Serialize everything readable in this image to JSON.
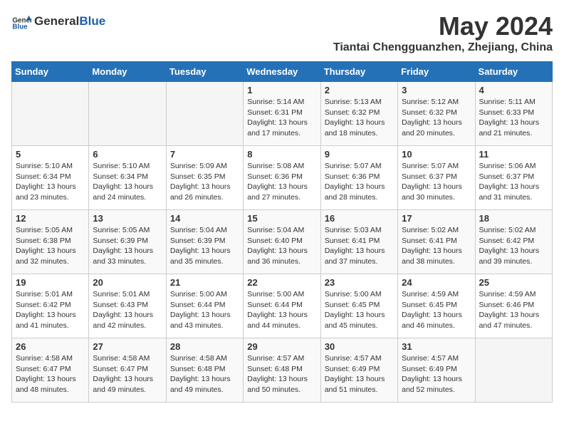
{
  "header": {
    "logo_general": "General",
    "logo_blue": "Blue",
    "month_title": "May 2024",
    "location": "Tiantai Chengguanzhen, Zhejiang, China"
  },
  "weekdays": [
    "Sunday",
    "Monday",
    "Tuesday",
    "Wednesday",
    "Thursday",
    "Friday",
    "Saturday"
  ],
  "weeks": [
    [
      {
        "day": "",
        "sunrise": "",
        "sunset": "",
        "daylight": ""
      },
      {
        "day": "",
        "sunrise": "",
        "sunset": "",
        "daylight": ""
      },
      {
        "day": "",
        "sunrise": "",
        "sunset": "",
        "daylight": ""
      },
      {
        "day": "1",
        "sunrise": "5:14 AM",
        "sunset": "6:31 PM",
        "daylight": "13 hours and 17 minutes."
      },
      {
        "day": "2",
        "sunrise": "5:13 AM",
        "sunset": "6:32 PM",
        "daylight": "13 hours and 18 minutes."
      },
      {
        "day": "3",
        "sunrise": "5:12 AM",
        "sunset": "6:32 PM",
        "daylight": "13 hours and 20 minutes."
      },
      {
        "day": "4",
        "sunrise": "5:11 AM",
        "sunset": "6:33 PM",
        "daylight": "13 hours and 21 minutes."
      }
    ],
    [
      {
        "day": "5",
        "sunrise": "5:10 AM",
        "sunset": "6:34 PM",
        "daylight": "13 hours and 23 minutes."
      },
      {
        "day": "6",
        "sunrise": "5:10 AM",
        "sunset": "6:34 PM",
        "daylight": "13 hours and 24 minutes."
      },
      {
        "day": "7",
        "sunrise": "5:09 AM",
        "sunset": "6:35 PM",
        "daylight": "13 hours and 26 minutes."
      },
      {
        "day": "8",
        "sunrise": "5:08 AM",
        "sunset": "6:36 PM",
        "daylight": "13 hours and 27 minutes."
      },
      {
        "day": "9",
        "sunrise": "5:07 AM",
        "sunset": "6:36 PM",
        "daylight": "13 hours and 28 minutes."
      },
      {
        "day": "10",
        "sunrise": "5:07 AM",
        "sunset": "6:37 PM",
        "daylight": "13 hours and 30 minutes."
      },
      {
        "day": "11",
        "sunrise": "5:06 AM",
        "sunset": "6:37 PM",
        "daylight": "13 hours and 31 minutes."
      }
    ],
    [
      {
        "day": "12",
        "sunrise": "5:05 AM",
        "sunset": "6:38 PM",
        "daylight": "13 hours and 32 minutes."
      },
      {
        "day": "13",
        "sunrise": "5:05 AM",
        "sunset": "6:39 PM",
        "daylight": "13 hours and 33 minutes."
      },
      {
        "day": "14",
        "sunrise": "5:04 AM",
        "sunset": "6:39 PM",
        "daylight": "13 hours and 35 minutes."
      },
      {
        "day": "15",
        "sunrise": "5:04 AM",
        "sunset": "6:40 PM",
        "daylight": "13 hours and 36 minutes."
      },
      {
        "day": "16",
        "sunrise": "5:03 AM",
        "sunset": "6:41 PM",
        "daylight": "13 hours and 37 minutes."
      },
      {
        "day": "17",
        "sunrise": "5:02 AM",
        "sunset": "6:41 PM",
        "daylight": "13 hours and 38 minutes."
      },
      {
        "day": "18",
        "sunrise": "5:02 AM",
        "sunset": "6:42 PM",
        "daylight": "13 hours and 39 minutes."
      }
    ],
    [
      {
        "day": "19",
        "sunrise": "5:01 AM",
        "sunset": "6:42 PM",
        "daylight": "13 hours and 41 minutes."
      },
      {
        "day": "20",
        "sunrise": "5:01 AM",
        "sunset": "6:43 PM",
        "daylight": "13 hours and 42 minutes."
      },
      {
        "day": "21",
        "sunrise": "5:00 AM",
        "sunset": "6:44 PM",
        "daylight": "13 hours and 43 minutes."
      },
      {
        "day": "22",
        "sunrise": "5:00 AM",
        "sunset": "6:44 PM",
        "daylight": "13 hours and 44 minutes."
      },
      {
        "day": "23",
        "sunrise": "5:00 AM",
        "sunset": "6:45 PM",
        "daylight": "13 hours and 45 minutes."
      },
      {
        "day": "24",
        "sunrise": "4:59 AM",
        "sunset": "6:45 PM",
        "daylight": "13 hours and 46 minutes."
      },
      {
        "day": "25",
        "sunrise": "4:59 AM",
        "sunset": "6:46 PM",
        "daylight": "13 hours and 47 minutes."
      }
    ],
    [
      {
        "day": "26",
        "sunrise": "4:58 AM",
        "sunset": "6:47 PM",
        "daylight": "13 hours and 48 minutes."
      },
      {
        "day": "27",
        "sunrise": "4:58 AM",
        "sunset": "6:47 PM",
        "daylight": "13 hours and 49 minutes."
      },
      {
        "day": "28",
        "sunrise": "4:58 AM",
        "sunset": "6:48 PM",
        "daylight": "13 hours and 49 minutes."
      },
      {
        "day": "29",
        "sunrise": "4:57 AM",
        "sunset": "6:48 PM",
        "daylight": "13 hours and 50 minutes."
      },
      {
        "day": "30",
        "sunrise": "4:57 AM",
        "sunset": "6:49 PM",
        "daylight": "13 hours and 51 minutes."
      },
      {
        "day": "31",
        "sunrise": "4:57 AM",
        "sunset": "6:49 PM",
        "daylight": "13 hours and 52 minutes."
      },
      {
        "day": "",
        "sunrise": "",
        "sunset": "",
        "daylight": ""
      }
    ]
  ],
  "labels": {
    "sunrise": "Sunrise:",
    "sunset": "Sunset:",
    "daylight": "Daylight:"
  }
}
